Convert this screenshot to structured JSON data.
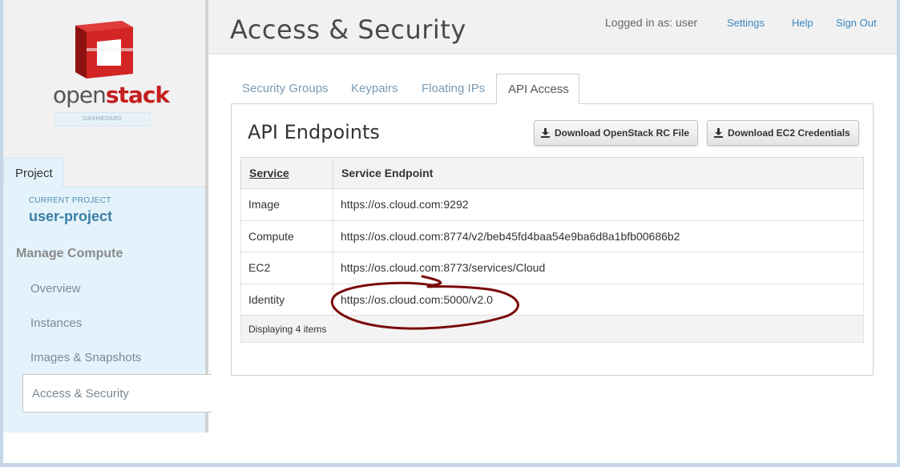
{
  "brand": {
    "name_part1": "open",
    "name_part2": "stack",
    "sub": "DASHBOARD",
    "accent": "#c51f1f"
  },
  "sidebar": {
    "project_tab": "Project",
    "current_project_label": "CURRENT PROJECT",
    "current_project_name": "user-project",
    "section_title": "Manage Compute",
    "items": [
      {
        "label": "Overview"
      },
      {
        "label": "Instances"
      },
      {
        "label": "Images & Snapshots"
      },
      {
        "label": "Access & Security",
        "active": true
      }
    ]
  },
  "header": {
    "title": "Access & Security",
    "logged_in": "Logged in as: user",
    "links": [
      "Settings",
      "Help",
      "Sign Out"
    ],
    "link_color": "#3a87c0"
  },
  "tabs": [
    {
      "label": "Security Groups"
    },
    {
      "label": "Keypairs"
    },
    {
      "label": "Floating IPs"
    },
    {
      "label": "API Access",
      "active": true
    }
  ],
  "panel": {
    "title": "API Endpoints",
    "buttons": [
      "Download OpenStack RC File",
      "Download EC2 Credentials"
    ],
    "button_icon": "download-icon"
  },
  "table": {
    "headers": [
      "Service",
      "Service Endpoint"
    ],
    "rows": [
      [
        "Image",
        "https://os.cloud.com:9292"
      ],
      [
        "Compute",
        "https://os.cloud.com:8774/v2/beb45fd4baa54e9ba6d8a1bfb00686b2"
      ],
      [
        "EC2",
        "https://os.cloud.com:8773/services/Cloud"
      ],
      [
        "Identity",
        "https://os.cloud.com:5000/v2.0"
      ]
    ],
    "footer": "Displaying 4 items"
  },
  "annotation": {
    "shape": "hand-drawn ellipse around Identity endpoint",
    "color": "#7a0a0a"
  }
}
